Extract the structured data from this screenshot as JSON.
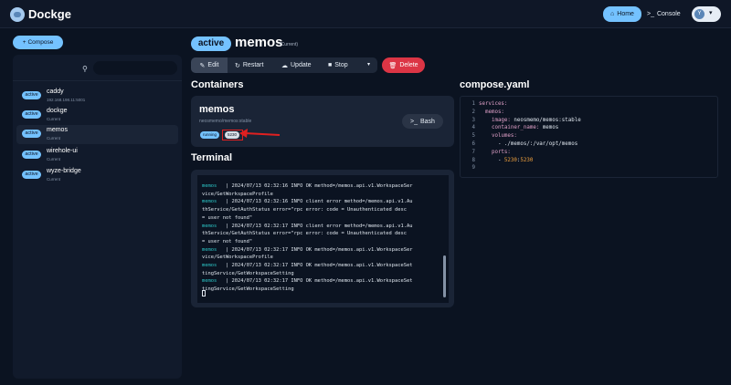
{
  "header": {
    "brand": "Dockge",
    "home_label": "Home",
    "console_label": "Console",
    "avatar_initial": "Y"
  },
  "sidebar": {
    "compose_label": "Compose",
    "search_placeholder": "",
    "stacks": [
      {
        "badge": "active",
        "name": "caddy",
        "sub": "192.168.198.11:5001",
        "selected": false
      },
      {
        "badge": "active",
        "name": "dockge",
        "sub": "Current",
        "selected": false
      },
      {
        "badge": "active",
        "name": "memos",
        "sub": "Current",
        "selected": true
      },
      {
        "badge": "active",
        "name": "wirehole-ui",
        "sub": "Current",
        "selected": false
      },
      {
        "badge": "active",
        "name": "wyze-bridge",
        "sub": "Current",
        "selected": false
      }
    ]
  },
  "main": {
    "status_badge": "active",
    "title": "memos",
    "current_tag": "(Current)",
    "toolbar": {
      "edit": "Edit",
      "restart": "Restart",
      "update": "Update",
      "stop": "Stop",
      "delete": "Delete"
    },
    "containers_heading": "Containers",
    "container": {
      "name": "memos",
      "image": "neosmemo/memos:stable",
      "state": "running",
      "port": "5230",
      "bash_label": "Bash"
    },
    "terminal_heading": "Terminal",
    "terminal_lines": [
      {
        "svc": "memos",
        "text": "   | 2024/07/13 02:32:16 INFO OK method=/memos.api.v1.WorkspaceSer"
      },
      {
        "svc": "",
        "text": "vice/GetWorkspaceProfile"
      },
      {
        "svc": "memos",
        "text": "   | 2024/07/13 02:32:16 INFO client error method=/memos.api.v1.Au"
      },
      {
        "svc": "",
        "text": "thService/GetAuthStatus error=\"rpc error: code = Unauthenticated desc"
      },
      {
        "svc": "",
        "text": "= user not found\""
      },
      {
        "svc": "memos",
        "text": "   | 2024/07/13 02:32:17 INFO client error method=/memos.api.v1.Au"
      },
      {
        "svc": "",
        "text": "thService/GetAuthStatus error=\"rpc error: code = Unauthenticated desc"
      },
      {
        "svc": "",
        "text": "= user not found\""
      },
      {
        "svc": "memos",
        "text": "   | 2024/07/13 02:32:17 INFO OK method=/memos.api.v1.WorkspaceSer"
      },
      {
        "svc": "",
        "text": "vice/GetWorkspaceProfile"
      },
      {
        "svc": "memos",
        "text": "   | 2024/07/13 02:32:17 INFO OK method=/memos.api.v1.WorkspaceSet"
      },
      {
        "svc": "",
        "text": "tingService/GetWorkspaceSetting"
      },
      {
        "svc": "memos",
        "text": "   | 2024/07/13 02:32:17 INFO OK method=/memos.api.v1.WorkspaceSet"
      },
      {
        "svc": "",
        "text": "tingService/GetWorkspaceSetting"
      }
    ],
    "yaml_heading": "compose.yaml",
    "yaml_lines": [
      {
        "n": "1",
        "parts": [
          {
            "c": "yk",
            "t": "services:"
          }
        ]
      },
      {
        "n": "2",
        "parts": [
          {
            "c": "yk",
            "t": "  memos:"
          }
        ]
      },
      {
        "n": "3",
        "parts": [
          {
            "c": "yk",
            "t": "    image: "
          },
          {
            "c": "yv",
            "t": "neosmemo/memos:stable"
          }
        ]
      },
      {
        "n": "4",
        "parts": [
          {
            "c": "yk",
            "t": "    container_name: "
          },
          {
            "c": "yv",
            "t": "memos"
          }
        ]
      },
      {
        "n": "5",
        "parts": [
          {
            "c": "yk",
            "t": "    volumes:"
          }
        ]
      },
      {
        "n": "6",
        "parts": [
          {
            "c": "yv",
            "t": "      - ./memos/:/var/opt/memos"
          }
        ]
      },
      {
        "n": "7",
        "parts": [
          {
            "c": "yk",
            "t": "    ports:"
          }
        ]
      },
      {
        "n": "8",
        "parts": [
          {
            "c": "yv",
            "t": "      - "
          },
          {
            "c": "yn",
            "t": "5230"
          },
          {
            "c": "yv",
            "t": ":"
          },
          {
            "c": "yn",
            "t": "5230"
          }
        ]
      },
      {
        "n": "9",
        "parts": []
      }
    ]
  },
  "colors": {
    "accent": "#74c2ff",
    "danger": "#dc3545",
    "background": "#0b1321",
    "panel": "#111a2b"
  }
}
